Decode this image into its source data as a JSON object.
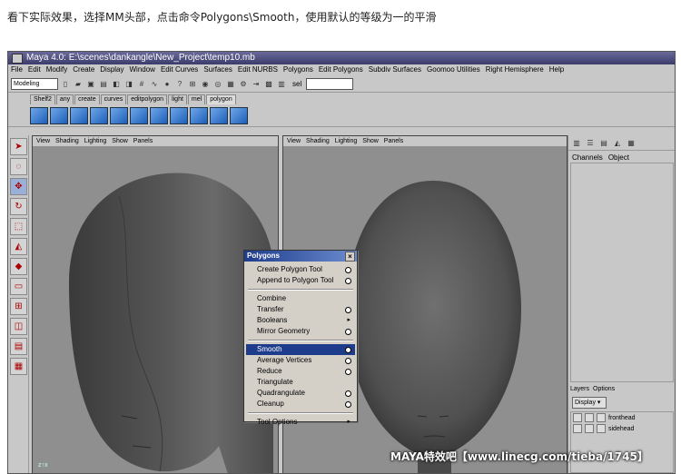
{
  "caption": "看下实际效果，选择MM头部，点击命令Polygons\\Smooth，使用默认的等级为一的平滑",
  "window": {
    "title": "Maya 4.0: E:\\scenes\\dankangle\\New_Project\\temp10.mb"
  },
  "menubar": [
    "File",
    "Edit",
    "Modify",
    "Create",
    "Display",
    "Window",
    "Edit Curves",
    "Surfaces",
    "Edit NURBS",
    "Polygons",
    "Edit Polygons",
    "Subdiv Surfaces",
    "Goomoo Utilities",
    "Right Hemisphere",
    "Help"
  ],
  "statusline": {
    "mode": "Modeling",
    "sel_label": "sel"
  },
  "shelf": {
    "tabs": [
      "Shelf2",
      "any",
      "create",
      "curves",
      "editpolygon",
      "light",
      "mel",
      "polygon"
    ],
    "active": "polygon"
  },
  "viewport_menu": [
    "View",
    "Shading",
    "Lighting",
    "Show",
    "Panels"
  ],
  "channel_box": {
    "tabs": [
      "Channels",
      "Object"
    ]
  },
  "layers": {
    "tabs": [
      "Layers",
      "Options"
    ],
    "dropdown": "Display",
    "items": [
      "fronthead",
      "sidehead"
    ]
  },
  "popup": {
    "title": "Polygons",
    "close": "×",
    "group1": [
      {
        "label": "Create Polygon Tool"
      },
      {
        "label": "Append to Polygon Tool"
      }
    ],
    "group2": [
      {
        "label": "Combine"
      },
      {
        "label": "Transfer"
      },
      {
        "label": "Booleans"
      },
      {
        "label": "Mirror Geometry"
      }
    ],
    "group3": [
      {
        "label": "Smooth"
      },
      {
        "label": "Average Vertices"
      },
      {
        "label": "Reduce"
      },
      {
        "label": "Triangulate"
      },
      {
        "label": "Quadrangulate"
      },
      {
        "label": "Cleanup"
      }
    ],
    "group4": [
      {
        "label": "Tool Options"
      }
    ]
  },
  "watermark": "MAYA特效吧【www.linecg.com/tieba/1745】",
  "colors": {
    "title_bar": "#3c3c6c",
    "menu_highlight": "#1e3c8c",
    "viewport_bg": "#8f8f8f"
  }
}
